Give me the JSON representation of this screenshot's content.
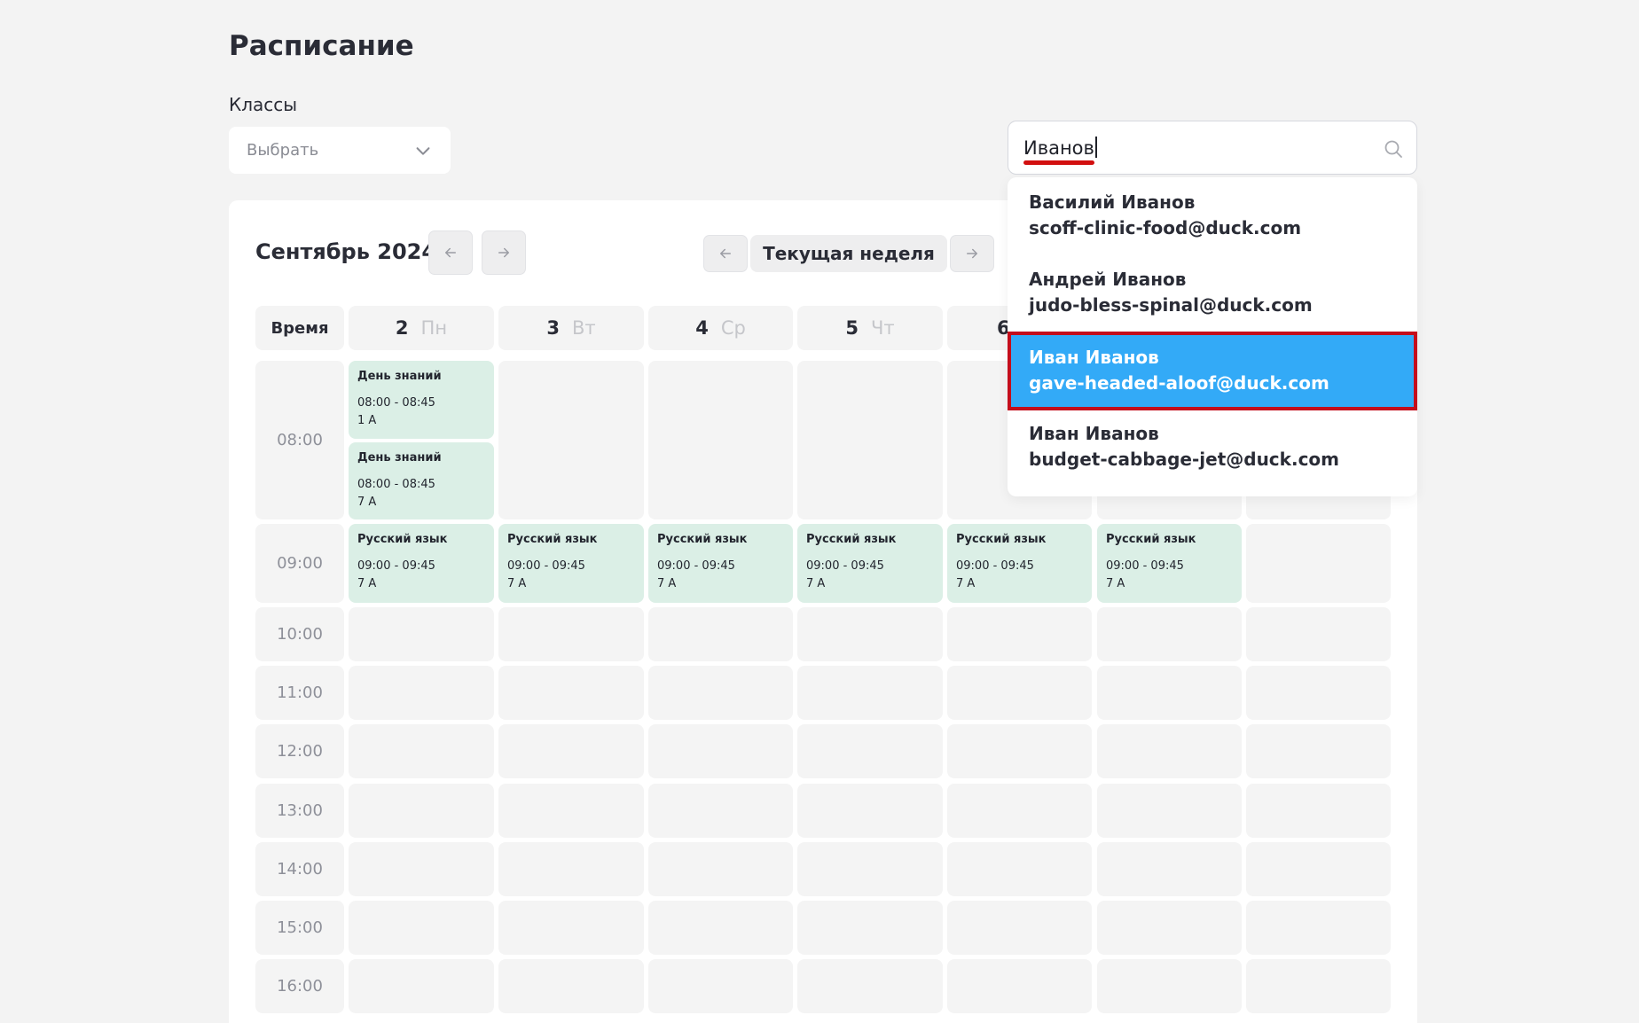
{
  "page": {
    "title": "Расписание"
  },
  "classes": {
    "label": "Классы",
    "select_value": "Выбрать"
  },
  "search": {
    "value": "Иванов"
  },
  "calendar": {
    "month": "Сентябрь 2024",
    "current_week_label": "Текущая неделя",
    "time_header": "Время",
    "days": [
      {
        "num": "2",
        "dow": "Пн"
      },
      {
        "num": "3",
        "dow": "Вт"
      },
      {
        "num": "4",
        "dow": "Ср"
      },
      {
        "num": "5",
        "dow": "Чт"
      },
      {
        "num": "6",
        "dow": ""
      }
    ],
    "times": [
      "08:00",
      "09:00",
      "10:00",
      "11:00",
      "12:00",
      "13:00",
      "14:00",
      "15:00",
      "16:00"
    ],
    "events": [
      {
        "title": "День знаний",
        "time": "08:00 - 08:45",
        "class": "1 А"
      },
      {
        "title": "День знаний",
        "time": "08:00 - 08:45",
        "class": "7 А"
      },
      {
        "title": "Русский язык",
        "time": "09:00 - 09:45",
        "class": "7 А"
      },
      {
        "title": "Русский язык",
        "time": "09:00 - 09:45",
        "class": "7 А"
      },
      {
        "title": "Русский язык",
        "time": "09:00 - 09:45",
        "class": "7 А"
      },
      {
        "title": "Русский язык",
        "time": "09:00 - 09:45",
        "class": "7 А"
      },
      {
        "title": "Русский язык",
        "time": "09:00 - 09:45",
        "class": "7 А"
      },
      {
        "title": "Русский язык",
        "time": "09:00 - 09:45",
        "class": "7 А"
      }
    ]
  },
  "dropdown": {
    "options": [
      {
        "name": "Василий Иванов",
        "email": "scoff-clinic-food@duck.com"
      },
      {
        "name": "Андрей Иванов",
        "email": "judo-bless-spinal@duck.com"
      },
      {
        "name": "Иван Иванов",
        "email": "gave-headed-aloof@duck.com"
      },
      {
        "name": "Иван Иванов",
        "email": "budget-cabbage-jet@duck.com"
      }
    ],
    "selected_index": 2
  },
  "colors": {
    "selected_bg": "#33aaf7",
    "highlight_border": "#c40d1b",
    "event_bg": "#dbefe6"
  }
}
